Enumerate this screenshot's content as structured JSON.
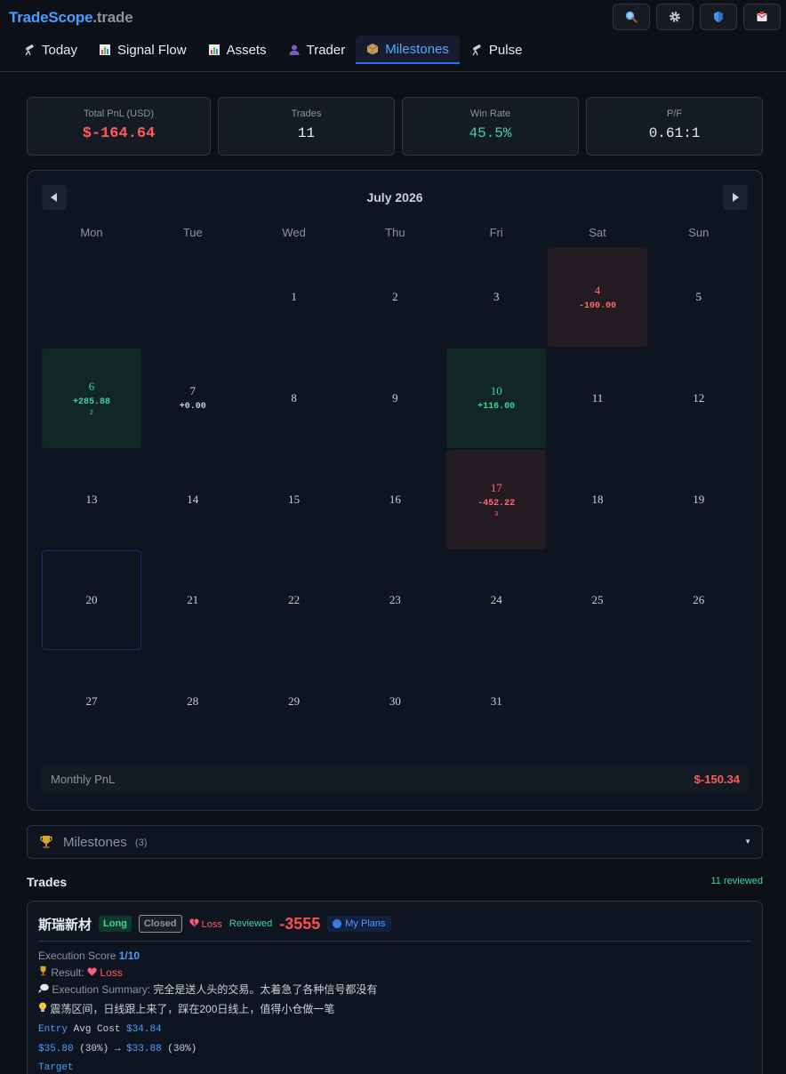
{
  "brand": {
    "part1": "TradeScope",
    "part2": ".trade"
  },
  "header_icons": [
    "search-icon",
    "gear-icon",
    "shield-icon",
    "inbox-icon"
  ],
  "nav": {
    "tabs": [
      {
        "label": "Today",
        "icon": "telescope-icon"
      },
      {
        "label": "Signal Flow",
        "icon": "bar-chart-icon"
      },
      {
        "label": "Assets",
        "icon": "bar-chart-icon"
      },
      {
        "label": "Trader",
        "icon": "person-icon"
      },
      {
        "label": "Milestones",
        "icon": "package-icon",
        "active": true
      },
      {
        "label": "Pulse",
        "icon": "telescope-icon"
      }
    ]
  },
  "stats": [
    {
      "label": "Total PnL (USD)",
      "value": "$-164.64",
      "color": "#ff5a5a"
    },
    {
      "label": "Trades",
      "value": "11",
      "color": "#e6edf3"
    },
    {
      "label": "Win Rate",
      "value": "45.5%",
      "color": "#3fd3a0"
    },
    {
      "label": "P/F",
      "value": "0.61:1",
      "color": "#e6edf3"
    }
  ],
  "calendar": {
    "month_label": "July 2026",
    "weekdays": [
      "Mon",
      "Tue",
      "Wed",
      "Thu",
      "Fri",
      "Sat",
      "Sun"
    ],
    "days": [
      {
        "num": "1"
      },
      {
        "num": "2"
      },
      {
        "num": "3"
      },
      {
        "num": "4",
        "pnl": "-100.00",
        "state": "neg"
      },
      {
        "num": "5"
      },
      {
        "num": "6",
        "pnl": "+285.88",
        "count": "2",
        "state": "pos"
      },
      {
        "num": "7",
        "pnl": "+0.00",
        "state": "zero"
      },
      {
        "num": "8"
      },
      {
        "num": "9"
      },
      {
        "num": "10",
        "pnl": "+116.00",
        "state": "pos"
      },
      {
        "num": "11"
      },
      {
        "num": "12"
      },
      {
        "num": "13"
      },
      {
        "num": "14"
      },
      {
        "num": "15"
      },
      {
        "num": "16"
      },
      {
        "num": "17",
        "pnl": "-452.22",
        "count": "3",
        "state": "neg"
      },
      {
        "num": "18"
      },
      {
        "num": "19"
      },
      {
        "num": "20",
        "state": "today"
      },
      {
        "num": "21"
      },
      {
        "num": "22"
      },
      {
        "num": "23"
      },
      {
        "num": "24"
      },
      {
        "num": "25"
      },
      {
        "num": "26"
      },
      {
        "num": "27"
      },
      {
        "num": "28"
      },
      {
        "num": "29"
      },
      {
        "num": "30"
      },
      {
        "num": "31"
      }
    ],
    "monthly_label": "Monthly PnL",
    "monthly_value": "$-150.34"
  },
  "milestones": {
    "title": "Milestones",
    "count": "(3)"
  },
  "trades": {
    "title": "Trades",
    "reviewed": "11 reviewed",
    "card": {
      "name": "斯瑞新材",
      "side": "Long",
      "status": "Closed",
      "result_tag": "Loss",
      "reviewed_tag": "Reviewed",
      "pnl": "-3555",
      "plan": "My Plans",
      "score_label": "Execution Score",
      "score_value": "1/10",
      "result_label": "Result:",
      "result_value": "Loss",
      "summary_label": "Execution Summary:",
      "summary_text": "完全是送人头的交易。太着急了各种信号都没有",
      "idea_text": "震荡区间，日线跟上来了，踩在200日线上，值得小仓做一笔",
      "entry_label": "Entry",
      "avg_cost_label": "Avg Cost",
      "avg_cost_value": "$34.84",
      "exit_from": "$35.80",
      "exit_from_pct": "(30%)",
      "arrow": "→",
      "exit_to": "$33.88",
      "exit_to_pct": "(30%)",
      "target_label": "Target"
    }
  }
}
